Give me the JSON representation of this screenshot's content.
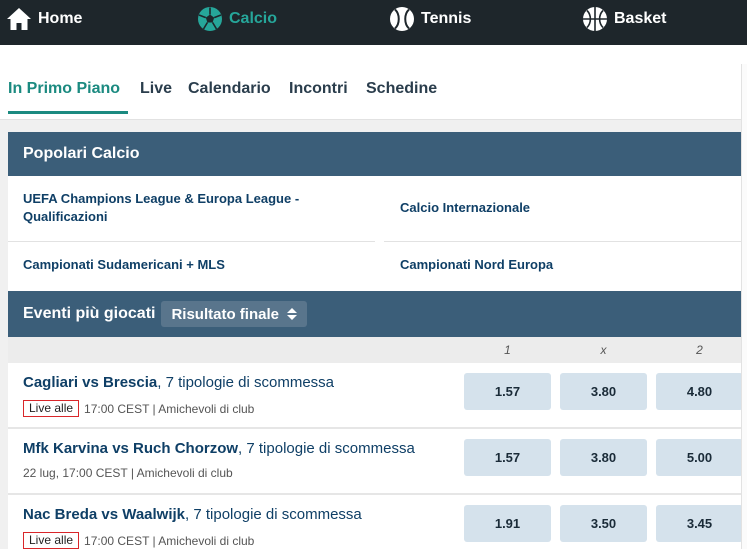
{
  "nav": {
    "home": {
      "label": "Home",
      "icon": "home-icon"
    },
    "calcio": {
      "label": "Calcio",
      "icon": "soccer-ball-icon"
    },
    "tennis": {
      "label": "Tennis",
      "icon": "tennis-ball-icon"
    },
    "basket": {
      "label": "Basket",
      "icon": "basketball-icon"
    }
  },
  "tabs": [
    "In Primo Piano",
    "Live",
    "Calendario",
    "Incontri",
    "Schedine"
  ],
  "popolari": {
    "title": "Popolari Calcio",
    "links": [
      "UEFA Champions League & Europa League - Qualificazioni",
      "Calcio Internazionale",
      "Campionati Sudamericani + MLS",
      "Campionati Nord Europa"
    ]
  },
  "eventi": {
    "title": "Eventi più giocati",
    "dropdown": "Risultato finale",
    "columns": [
      "1",
      "x",
      "2"
    ],
    "events": [
      {
        "teams": "Cagliari vs Brescia",
        "bet_types": ", 7 tipologie di scommessa",
        "live": "Live alle",
        "date": "17:00 CEST | Amichevoli di club",
        "odds": [
          "1.57",
          "3.80",
          "4.80"
        ]
      },
      {
        "teams": "Mfk Karvina vs Ruch Chorzow",
        "bet_types": ", 7 tipologie di scommessa",
        "live": "",
        "date": "22 lug, 17:00 CEST | Amichevoli di club",
        "odds": [
          "1.57",
          "3.80",
          "5.00"
        ]
      },
      {
        "teams": "Nac Breda vs Waalwijk",
        "bet_types": ", 7 tipologie di scommessa",
        "live": "Live alle",
        "date": "17:00 CEST | Amichevoli di club",
        "odds": [
          "1.91",
          "3.50",
          "3.45"
        ]
      }
    ]
  },
  "colors": {
    "nav_bg": "#1e262b",
    "accent": "#26a69a",
    "section_bg": "#3b5e79",
    "odd_bg": "#d5e2ec",
    "link": "#0f3f66",
    "live_border": "#d9262a"
  }
}
